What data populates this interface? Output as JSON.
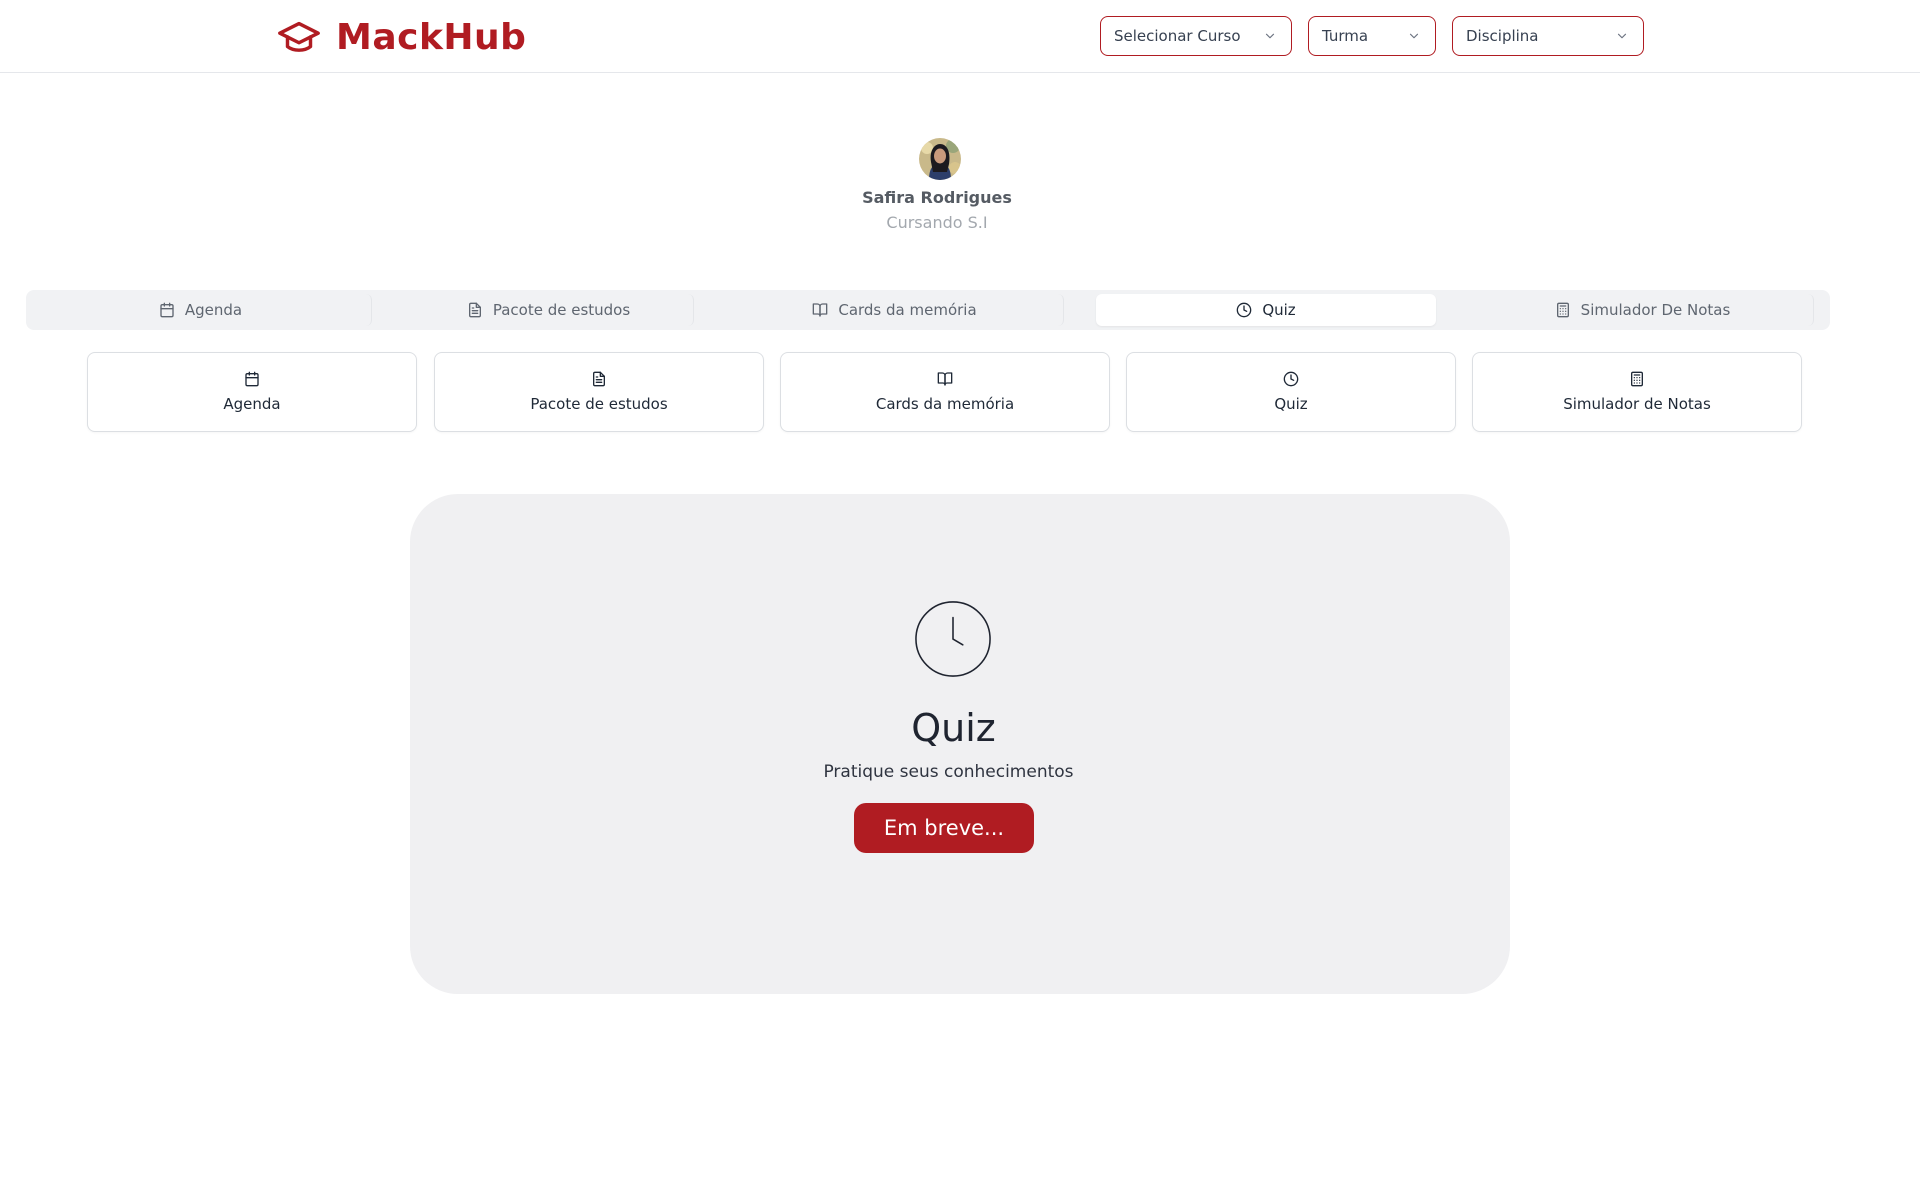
{
  "brand": {
    "name": "MackHub"
  },
  "filters": {
    "curso": "Selecionar Curso",
    "turma": "Turma",
    "disciplina": "Disciplina"
  },
  "profile": {
    "name": "Safira Rodrigues",
    "subtitle": "Cursando S.I"
  },
  "tabs": [
    {
      "label": "Agenda",
      "icon": "calendar-icon"
    },
    {
      "label": "Pacote de estudos",
      "icon": "document-icon"
    },
    {
      "label": "Cards da memória",
      "icon": "book-icon"
    },
    {
      "label": "Quiz",
      "icon": "clock-icon",
      "active": true
    },
    {
      "label": "Simulador De Notas",
      "icon": "calculator-icon"
    }
  ],
  "cards": [
    {
      "label": "Agenda",
      "icon": "calendar-icon"
    },
    {
      "label": "Pacote de estudos",
      "icon": "document-icon"
    },
    {
      "label": "Cards da memória",
      "icon": "book-icon"
    },
    {
      "label": "Quiz",
      "icon": "clock-icon"
    },
    {
      "label": "Simulador de Notas",
      "icon": "calculator-icon"
    }
  ],
  "panel": {
    "title": "Quiz",
    "subtitle": "Pratique seus conhecimentos",
    "button": "Em breve..."
  },
  "colors": {
    "accent": "#b01c22",
    "panel_bg": "#f0f0f2",
    "tabs_bg": "#f1f2f4"
  }
}
